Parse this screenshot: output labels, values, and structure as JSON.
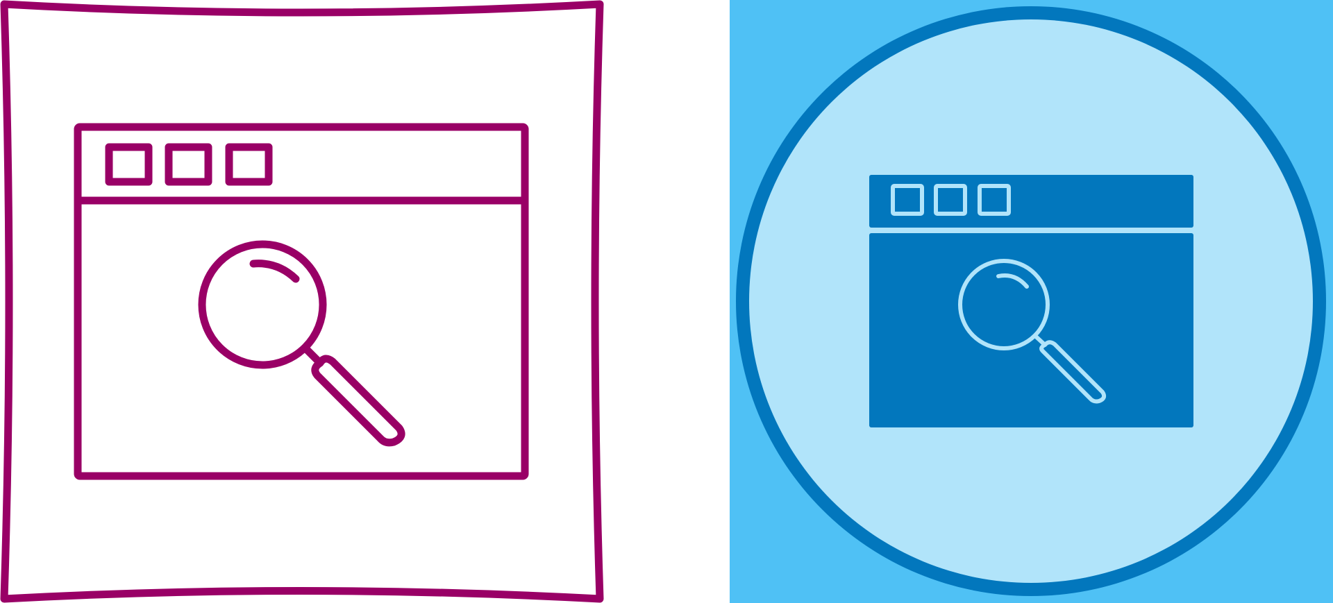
{
  "icons": [
    {
      "name": "browser-search-icon",
      "style": "outline",
      "stroke_color": "#990066",
      "fill_color": "#ffffff"
    },
    {
      "name": "browser-search-icon",
      "style": "glyph-circle",
      "background_color": "#4fc1f5",
      "ring_color": "#0277bd",
      "circle_fill": "#b1e4fa",
      "window_fill": "#0277bd",
      "line_color": "#b1e4fa"
    }
  ]
}
